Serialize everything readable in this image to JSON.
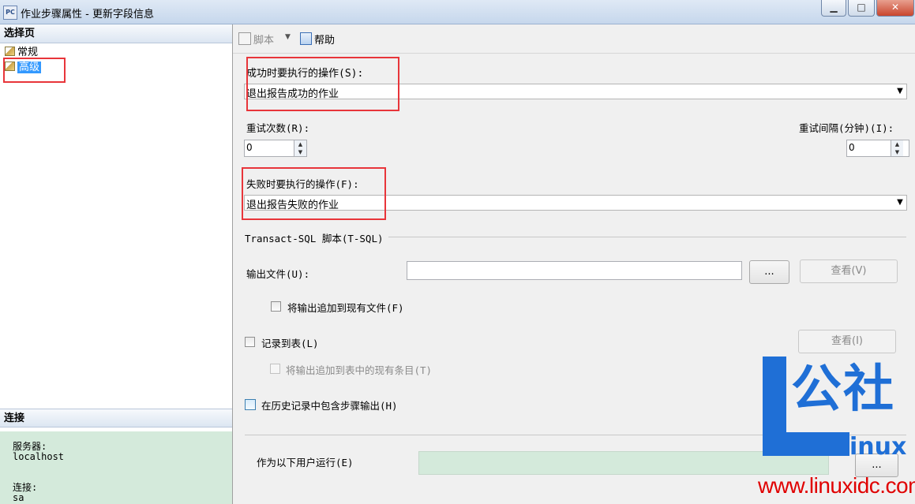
{
  "window": {
    "app_icon_text": "PC",
    "title": "作业步骤属性 - 更新字段信息",
    "buttons": {
      "minimize": "▁",
      "maximize": "□",
      "close": "✕"
    }
  },
  "left_panel": {
    "select_page_header": "选择页",
    "nav_items": [
      {
        "label": "常规",
        "icon": "page-properties-icon",
        "selected": false
      },
      {
        "label": "高级",
        "icon": "page-properties-icon",
        "selected": true
      }
    ],
    "connection_header": "连接",
    "connection": {
      "server_label": "服务器:",
      "server_value": "localhost",
      "conn_label": "连接:",
      "conn_value": "sa"
    }
  },
  "toolbar": {
    "script_label": "脚本",
    "script_icon": "script-icon",
    "dropdown_glyph": "▼",
    "help_label": "帮助",
    "help_icon": "help-icon"
  },
  "form": {
    "on_success_label": "成功时要执行的操作(S):",
    "on_success_value": "退出报告成功的作业",
    "retry_attempts_label": "重试次数(R):",
    "retry_attempts_value": "0",
    "retry_interval_label": "重试间隔(分钟)(I):",
    "retry_interval_value": "0",
    "on_failure_label": "失败时要执行的操作(F):",
    "on_failure_value": "退出报告失败的作业",
    "tsql_group_label": "Transact-SQL 脚本(T-SQL)",
    "output_file_label": "输出文件(U):",
    "output_file_value": "",
    "browse_label": "...",
    "view_output_label": "查看(V)",
    "append_output_label": "将输出追加到现有文件(F)",
    "log_to_table_label": "记录到表(L)",
    "view_table_label": "查看(I)",
    "append_table_label": "将输出追加到表中的现有条目(T)",
    "include_history_label": "在历史记录中包含步骤输出(H)",
    "run_as_label": "作为以下用户运行(E)",
    "run_as_value": "",
    "run_as_browse_label": "...",
    "arrow_glyph": "▼"
  },
  "watermark": {
    "gongshe": "公社",
    "inux": "inux",
    "url": "www.linuxidc.com"
  },
  "colors": {
    "accent": "#3399ff",
    "annotation_red": "#e8353a",
    "connection_bg": "#d4eadb",
    "watermark_blue": "#1f6fd6",
    "watermark_red": "#e00000"
  }
}
